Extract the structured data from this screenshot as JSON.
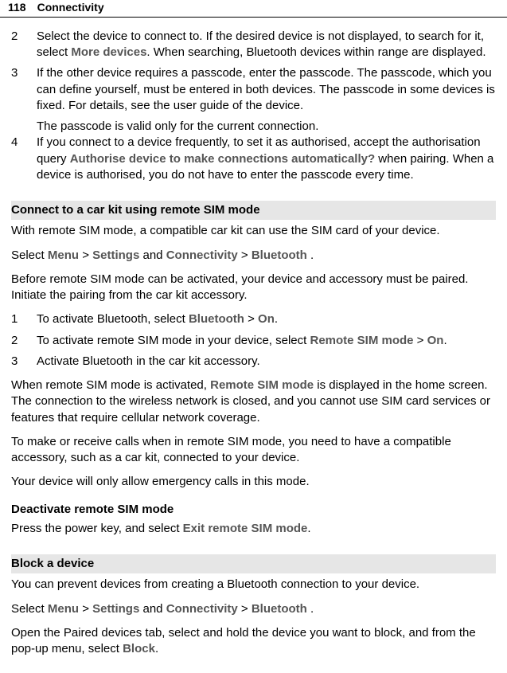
{
  "header": {
    "page_number": "118",
    "chapter_title": "Connectivity"
  },
  "intro_steps": [
    {
      "num": "2",
      "parts": [
        {
          "t": "Select the device to connect to. If the desired device is not displayed, to search for it, select "
        },
        {
          "b": "More devices"
        },
        {
          "t": ". When searching, Bluetooth devices within range are displayed."
        }
      ]
    },
    {
      "num": "3",
      "parts": [
        {
          "t": "If the other device requires a passcode, enter the passcode. The passcode, which you can define yourself, must be entered in both devices. The passcode in some devices is fixed. For details, see the user guide of the device."
        }
      ],
      "after": "The passcode is valid only for the current connection."
    },
    {
      "num": "4",
      "parts": [
        {
          "t": "If you connect to a device frequently, to set it as authorised, accept the authorisation query "
        },
        {
          "b": "Authorise device to make connections automatically?"
        },
        {
          "t": " when pairing. When a device is authorised, you do not have to enter the passcode every time."
        }
      ]
    }
  ],
  "s1": {
    "head": "Connect to a car kit using remote SIM mode",
    "p1a": "With remote SIM mode, a compatible car kit can use the SIM card of your device.",
    "nav_prefix": "Select ",
    "menu": "Menu",
    "gt1": " > ",
    "settings": "Settings",
    "and": " and ",
    "connectivity": "Connectivity",
    "gt2": " > ",
    "bluetooth": "Bluetooth",
    "dot": ".",
    "p3": "Before remote SIM mode can be activated, your device and accessory must be paired. Initiate the pairing from the car kit accessory.",
    "steps": [
      {
        "num": "1",
        "parts": [
          {
            "t": "To activate Bluetooth, select "
          },
          {
            "b": "Bluetooth"
          },
          {
            "t": " > "
          },
          {
            "b": "On"
          },
          {
            "t": "."
          }
        ]
      },
      {
        "num": "2",
        "parts": [
          {
            "t": "To activate remote SIM mode in your device, select "
          },
          {
            "b": "Remote SIM mode"
          },
          {
            "t": " > "
          },
          {
            "b": "On"
          },
          {
            "t": "."
          }
        ]
      },
      {
        "num": "3",
        "parts": [
          {
            "t": "Activate Bluetooth in the car kit accessory."
          }
        ]
      }
    ],
    "p4_parts": [
      {
        "t": "When remote SIM mode is activated, "
      },
      {
        "b": "Remote SIM mode"
      },
      {
        "t": " is displayed in the home screen. The connection to the wireless network is closed, and you cannot use SIM card services or features that require cellular network coverage."
      }
    ],
    "p5": "To make or receive calls when in remote SIM mode, you need to have a compatible accessory, such as a car kit, connected to your device.",
    "p6": "Your device will only allow emergency calls in this mode.",
    "deact_head": "Deactivate remote SIM mode",
    "deact_parts": [
      {
        "t": "Press the power key, and select "
      },
      {
        "b": "Exit remote SIM mode"
      },
      {
        "t": "."
      }
    ]
  },
  "s2": {
    "head": "Block a device",
    "p1": "You can prevent devices from creating a Bluetooth connection to your device.",
    "nav_prefix": "Select ",
    "menu": "Menu",
    "gt1": " > ",
    "settings": "Settings",
    "and": " and ",
    "connectivity": "Connectivity",
    "gt2": " > ",
    "bluetooth": "Bluetooth",
    "dot": ".",
    "p3_parts": [
      {
        "t": "Open the Paired devices tab, select and hold the device you want to block, and from the pop-up menu, select "
      },
      {
        "b": "Block"
      },
      {
        "t": "."
      }
    ]
  }
}
